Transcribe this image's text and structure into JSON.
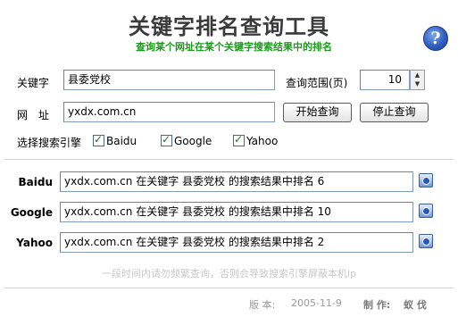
{
  "header": {
    "title": "关键字排名查询工具",
    "subtitle": "查询某个网址在某个关键字搜索结果中的排名",
    "help_glyph": "?"
  },
  "form": {
    "keyword_label": "关键字",
    "keyword_value": "县委党校",
    "range_label": "查询范围(页)",
    "range_value": "10",
    "url_label": "网　址",
    "url_value": "yxdx.com.cn",
    "start_button": "开始查询",
    "stop_button": "停止查询",
    "engines_label": "选择搜索引擎",
    "engines": [
      {
        "label": "Baidu",
        "checked": true
      },
      {
        "label": "Google",
        "checked": true
      },
      {
        "label": "Yahoo",
        "checked": true
      }
    ]
  },
  "results": [
    {
      "engine": "Baidu",
      "text": "yxdx.com.cn 在关键字 县委党校 的搜索结果中排名 6"
    },
    {
      "engine": "Google",
      "text": "yxdx.com.cn 在关键字 县委党校 的搜索结果中排名 10"
    },
    {
      "engine": "Yahoo",
      "text": "yxdx.com.cn 在关键字 县委党校 的搜索结果中排名 2"
    }
  ],
  "notice": "一段时间内请勿频繁查询，否则会导致搜索引擎屏蔽本机ip",
  "footer": {
    "version_label": "版 本:",
    "version_value": "2005-11-9",
    "author_label": "制 作:",
    "author_value": "蚁 伐"
  },
  "colors": {
    "subtitle": "#1a9a1a",
    "notice": "#c8c8c8",
    "help_button": "#2f5fc3"
  },
  "icons": {
    "help": "help-question-icon",
    "result": "ie-page-icon",
    "checkbox": "checkmark-icon",
    "spin_up": "arrow-up-icon",
    "spin_down": "arrow-down-icon"
  }
}
